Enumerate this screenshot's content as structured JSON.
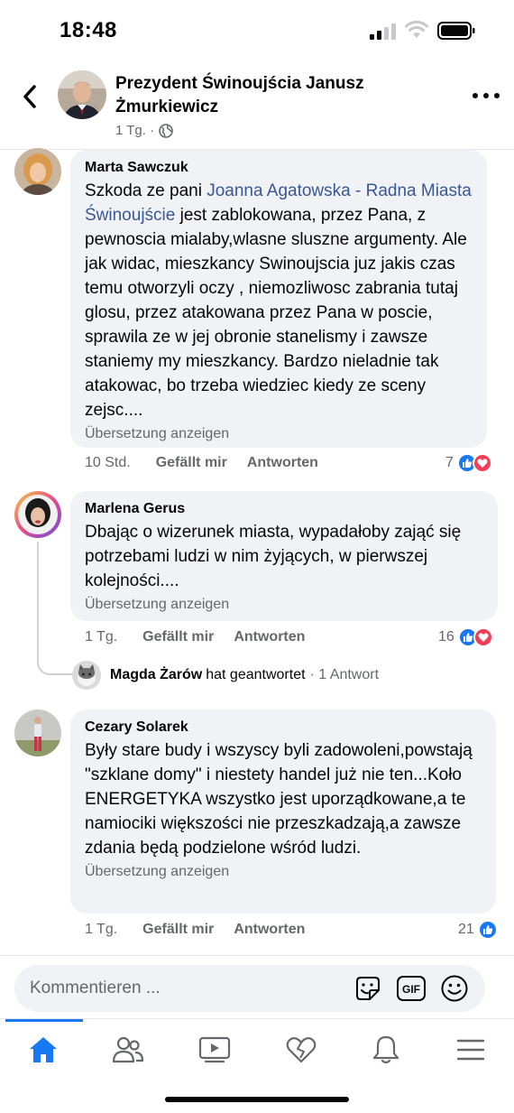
{
  "status_bar": {
    "time": "18:48"
  },
  "header": {
    "title": "Prezydent Świnoujścia Janusz Żmurkiewicz",
    "meta": "1 Tg. ·"
  },
  "comments": [
    {
      "author": "Marta Sawczuk",
      "text_before": "Szkoda ze pani ",
      "mention": "Joanna Agatowska - Radna Miasta Świnoujście",
      "text_after": " jest zablokowana, przez Pana, z pewnoscia mialaby,wlasne sluszne argumenty. Ale jak widac, mieszkancy Swinoujscia juz jakis czas temu otworzyli oczy , niemozliwosc zabrania tutaj glosu, przez atakowana przez Pana w poscie, sprawila ze w jej obronie stanelismy i zawsze staniemy my mieszkancy. Bardzo nieladnie tak atakowac, bo trzeba wiedziec kiedy ze sceny zejsc....",
      "translate": "Übersetzung anzeigen",
      "time": "10 Std.",
      "like": "Gefällt mir",
      "reply": "Antworten",
      "reactions": "7"
    },
    {
      "author": "Marlena Gerus",
      "text": "Dbając o wizerunek miasta, wypadałoby zająć się potrzebami ludzi w nim żyjących, w pierwszej kolejności....",
      "translate": "Übersetzung anzeigen",
      "time": "1 Tg.",
      "like": "Gefällt mir",
      "reply": "Antworten",
      "reactions": "16",
      "reply_preview": {
        "name": "Magda Żarów",
        "action": "hat geantwortet",
        "count": "· 1 Antwort"
      }
    },
    {
      "author": "Cezary Solarek",
      "text": "Były stare budy i wszyscy byli zadowoleni,powstają \"szklane domy\" i niestety handel już nie ten...Koło ENERGETYKA wszystko jest uporządkowane,a te namiociki większości nie przeszkadzają,a zawsze zdania będą podzielone wśród ludzi.",
      "translate": "Übersetzung anzeigen",
      "time": "1 Tg.",
      "like": "Gefällt mir",
      "reply": "Antworten",
      "reactions": "21"
    }
  ],
  "composer": {
    "placeholder": "Kommentieren ...",
    "gif_label": "GIF"
  },
  "colors": {
    "accent": "#1877f2",
    "love": "#f33e58",
    "bubble": "#f0f2f5",
    "secondary_text": "#65676b",
    "mention": "#385898"
  }
}
